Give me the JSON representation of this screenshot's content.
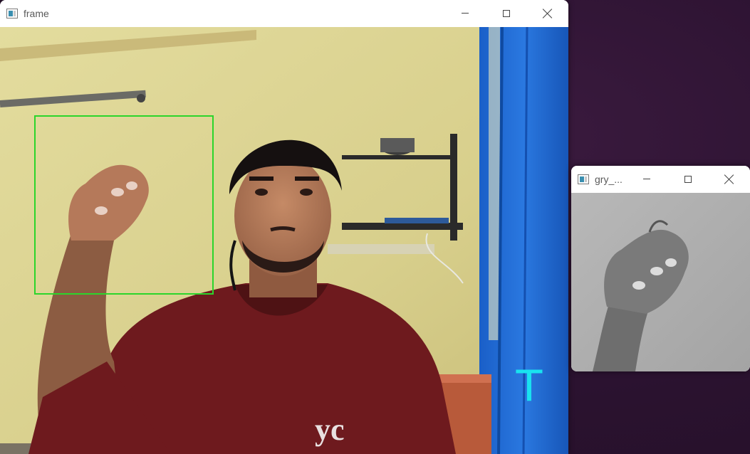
{
  "desktop": {
    "background_color": "#2b1230"
  },
  "windows": {
    "frame": {
      "title": "frame",
      "icon": "app-icon",
      "controls": [
        "minimize-icon",
        "maximize-icon",
        "close-icon"
      ],
      "overlay": {
        "detection_box_color": "#2bd52b",
        "predicted_letter": "T",
        "predicted_letter_color": "#19e3f0"
      }
    },
    "gry": {
      "title": "gry_...",
      "icon": "app-icon",
      "controls": [
        "minimize-icon",
        "maximize-icon",
        "close-icon"
      ]
    }
  }
}
